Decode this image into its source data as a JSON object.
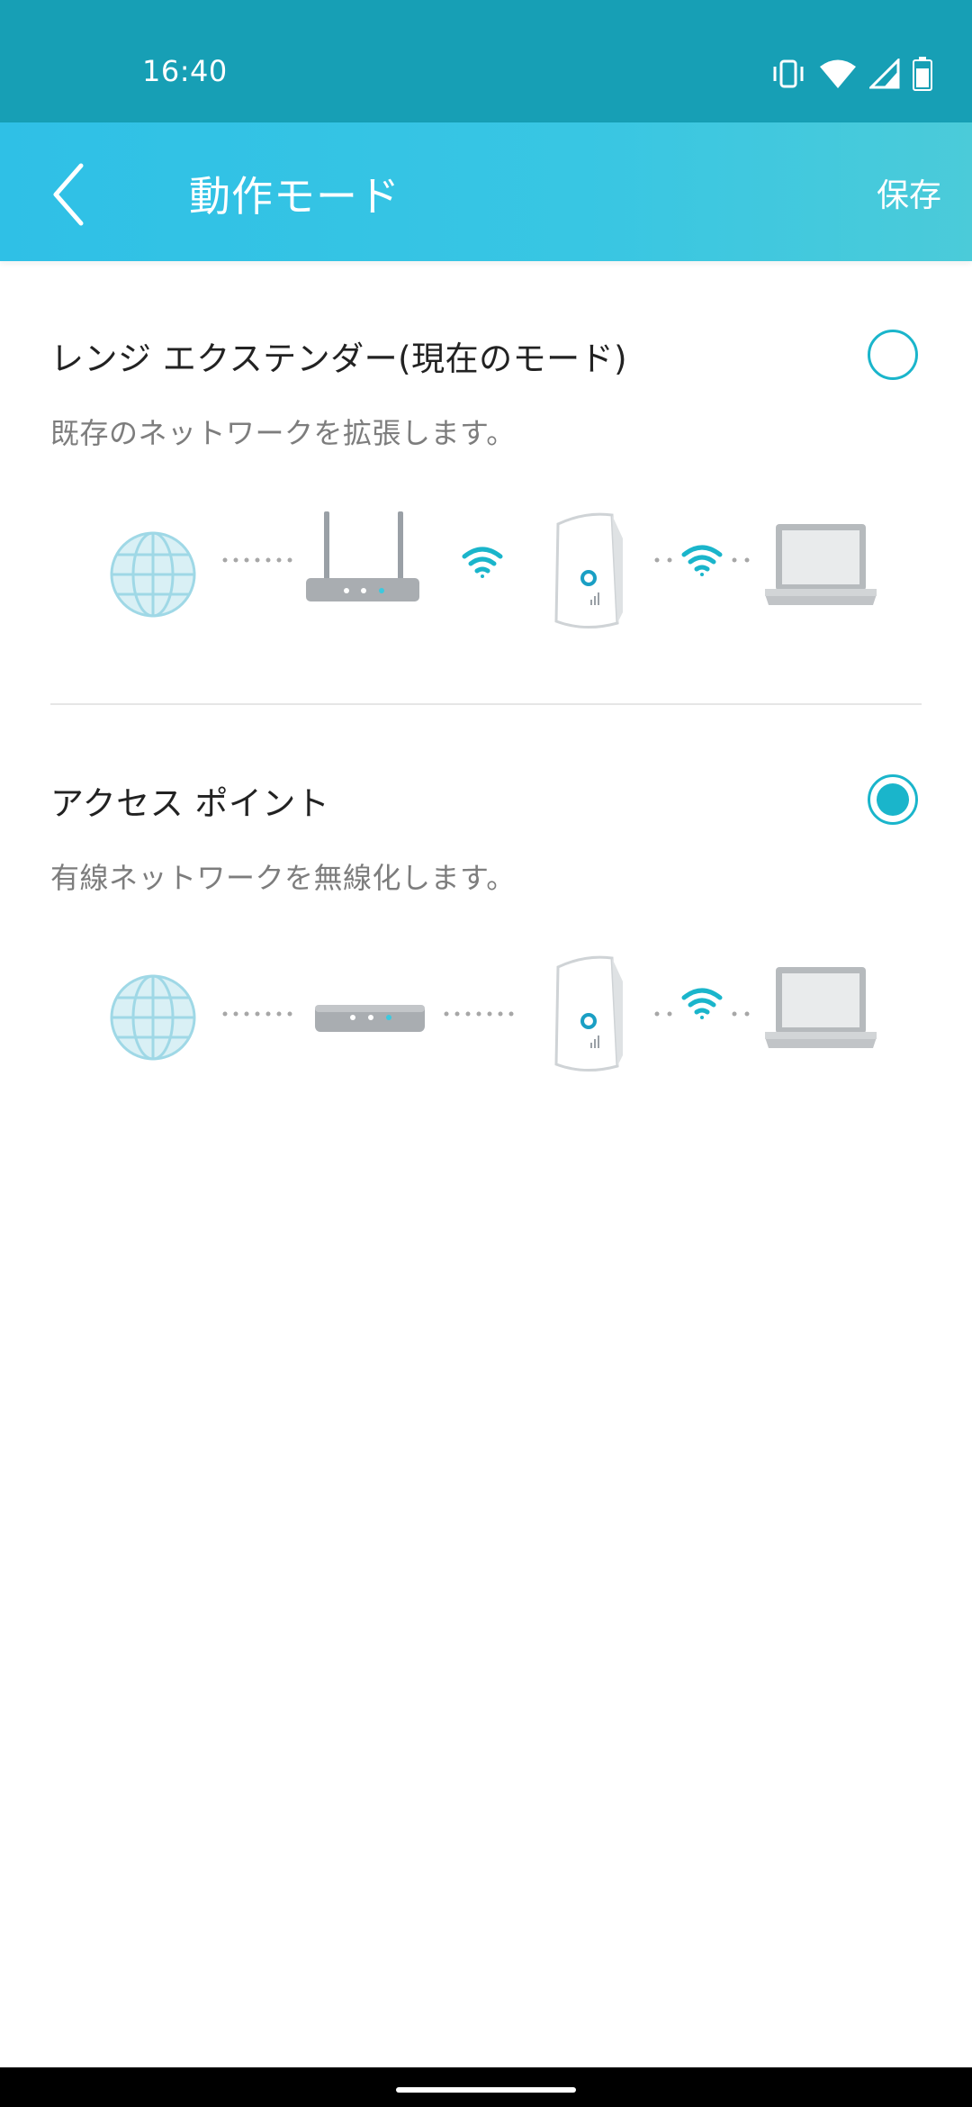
{
  "status_bar": {
    "time": "16:40",
    "icons": [
      "vibrate-icon",
      "wifi-icon",
      "cell-signal-icon",
      "battery-icon"
    ]
  },
  "app_bar": {
    "back_icon": "chevron-left-icon",
    "title": "動作モード",
    "save_label": "保存"
  },
  "modes": [
    {
      "title": "レンジ エクステンダー(現在のモード)",
      "description": "既存のネットワークを拡張します。",
      "selected": false,
      "diagram": [
        "globe-icon",
        "router-icon",
        "wifi-icon",
        "range-extender-icon",
        "wifi-icon",
        "laptop-icon"
      ]
    },
    {
      "title": "アクセス ポイント",
      "description": "有線ネットワークを無線化します。",
      "selected": true,
      "diagram": [
        "globe-icon",
        "modem-icon",
        "range-extender-icon",
        "wifi-icon",
        "laptop-icon"
      ]
    }
  ],
  "colors": {
    "status_bar": "#179fb5",
    "app_bar_start": "#2fc0e6",
    "app_bar_end": "#4bcbd9",
    "accent": "#1ab5cb"
  }
}
